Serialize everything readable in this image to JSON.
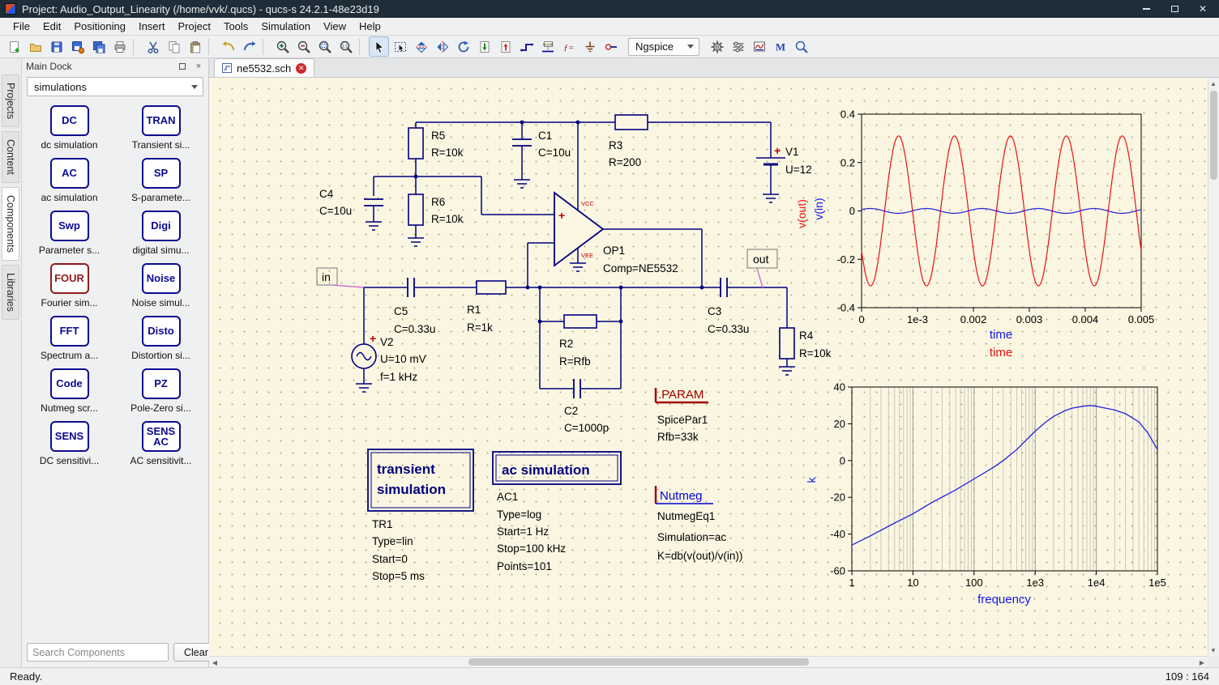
{
  "window": {
    "title": "Project: Audio_Output_Linearity (/home/vvk/.qucs) - qucs-s 24.2.1-48e23d19",
    "controls": [
      "minimize",
      "restore",
      "close"
    ]
  },
  "menus": [
    "File",
    "Edit",
    "Positioning",
    "Insert",
    "Project",
    "Tools",
    "Simulation",
    "View",
    "Help"
  ],
  "toolbar": {
    "simulator": "Ngspice",
    "icons": [
      "new",
      "open",
      "save",
      "save-as",
      "save-all",
      "print",
      "cut",
      "copy",
      "paste",
      "undo",
      "redo",
      "zoom-in",
      "zoom-out",
      "zoom-fit",
      "zoom-actual",
      "select",
      "select-area",
      "mirror-vertical",
      "mirror-horizontal",
      "rotate",
      "push-into",
      "pop-out",
      "wire",
      "node-name",
      "equation",
      "ground",
      "port",
      "simulate",
      "sim-settings",
      "display-data",
      "text-editor",
      "zoom-area"
    ]
  },
  "dock": {
    "title": "Main Dock",
    "selector": "simulations",
    "tabs": [
      "Projects",
      "Content",
      "Components",
      "Libraries"
    ],
    "items": [
      {
        "icon": "DC",
        "label": "dc simulation",
        "accent": "#0b0b8f"
      },
      {
        "icon": "TRAN",
        "label": "Transient si...",
        "accent": "#0b0b8f"
      },
      {
        "icon": "AC",
        "label": "ac simulation",
        "accent": "#0b0b8f"
      },
      {
        "icon": "SP",
        "label": "S-paramete...",
        "accent": "#0b0b8f"
      },
      {
        "icon": "Swp",
        "label": "Parameter s...",
        "accent": "#0b0b8f"
      },
      {
        "icon": "Digi",
        "label": "digital simu...",
        "accent": "#0b0b8f"
      },
      {
        "icon": "FOUR",
        "label": "Fourier sim...",
        "accent": "#8f1b1b"
      },
      {
        "icon": "Noise",
        "label": "Noise simul...",
        "accent": "#0b0b8f"
      },
      {
        "icon": "FFT",
        "label": "Spectrum a...",
        "accent": "#0b0b8f"
      },
      {
        "icon": "Disto",
        "label": "Distortion si...",
        "accent": "#0b0b8f"
      },
      {
        "icon": "Code",
        "label": "Nutmeg scr...",
        "accent": "#0b0b8f"
      },
      {
        "icon": "PZ",
        "label": "Pole-Zero si...",
        "accent": "#0b0b8f"
      },
      {
        "icon": "SENS",
        "label": "DC sensitivi...",
        "accent": "#0b0b8f"
      },
      {
        "icon": "SENS AC",
        "label": "AC sensitivit...",
        "accent": "#0b0b8f"
      }
    ],
    "search_placeholder": "Search Components",
    "clear_label": "Clear"
  },
  "canvas": {
    "tab": "ne5532.sch"
  },
  "schematic": {
    "colors": {
      "wire": "#000080",
      "accent_red": "#c00000",
      "label_link": "#d070d0"
    },
    "R5": {
      "name": "R5",
      "value": "R=10k"
    },
    "R6": {
      "name": "R6",
      "value": "R=10k"
    },
    "C4": {
      "name": "C4",
      "value": "C=10u"
    },
    "C1": {
      "name": "C1",
      "value": "C=10u"
    },
    "R3": {
      "name": "R3",
      "value": "R=200"
    },
    "V1": {
      "name": "V1",
      "value": "U=12",
      "plus": "+"
    },
    "OP1": {
      "name": "OP1",
      "value": "Comp=NE5532",
      "vcc": "VCC",
      "vee": "VEE",
      "plus": "+"
    },
    "C5": {
      "name": "C5",
      "value": "C=0.33u"
    },
    "R1": {
      "name": "R1",
      "value": "R=1k"
    },
    "V2": {
      "name": "V2",
      "value": "U=10 mV",
      "value2": "f=1 kHz",
      "plus": "+"
    },
    "R2": {
      "name": "R2",
      "value": "R=Rfb"
    },
    "C2": {
      "name": "C2",
      "value": "C=1000p"
    },
    "C3": {
      "name": "C3",
      "value": "C=0.33u"
    },
    "R4": {
      "name": "R4",
      "value": "R=10k"
    },
    "in_label": "in",
    "out_label": "out",
    "param": {
      "title": ".PARAM",
      "name": "SpicePar1",
      "value": "Rfb=33k"
    },
    "transient": {
      "title1": "transient",
      "title2": "simulation",
      "name": "TR1",
      "type": "Type=lin",
      "start": "Start=0",
      "stop": "Stop=5 ms"
    },
    "ac": {
      "title": "ac simulation",
      "name": "AC1",
      "type": "Type=log",
      "start": "Start=1 Hz",
      "stop": "Stop=100 kHz",
      "points": "Points=101"
    },
    "nutmeg": {
      "title": "Nutmeg",
      "name": "NutmegEq1",
      "sim": "Simulation=ac",
      "eq": "K=db(v(out)/v(in))"
    }
  },
  "chart_data": [
    {
      "type": "line",
      "name": "transient-waveforms",
      "xlim": [
        0,
        0.005
      ],
      "ylim": [
        -0.4,
        0.4
      ],
      "x_ticks": [
        {
          "v": 0,
          "label": "0"
        },
        {
          "v": 0.001,
          "label": "1e-3"
        },
        {
          "v": 0.002,
          "label": "0.002"
        },
        {
          "v": 0.003,
          "label": "0.003"
        },
        {
          "v": 0.004,
          "label": "0.004"
        },
        {
          "v": 0.005,
          "label": "0.005"
        }
      ],
      "y_ticks": [
        {
          "v": 0.4,
          "label": "0.4"
        },
        {
          "v": 0.2,
          "label": "0.2"
        },
        {
          "v": 0,
          "label": "0"
        },
        {
          "v": -0.2,
          "label": "-0.2"
        },
        {
          "v": -0.4,
          "label": "-0.4"
        }
      ],
      "axis_labels": {
        "x_blue": "time",
        "x_red": "time",
        "y_red": "v(out)",
        "y_blue": "v(in)"
      },
      "grid": false,
      "series": [
        {
          "name": "v(out)",
          "color": "#ee1111",
          "waveform": "sine",
          "amplitude": 0.31,
          "frequency_hz": 1000,
          "phase_rad": 3.7
        },
        {
          "name": "v(in)",
          "color": "#2222dd",
          "waveform": "sine",
          "amplitude": 0.01,
          "frequency_hz": 1000,
          "phase_rad": 0.6
        }
      ]
    },
    {
      "type": "line",
      "name": "gain-vs-frequency",
      "x_scale": "log",
      "xlim": [
        1,
        100000
      ],
      "ylim": [
        -60,
        40
      ],
      "x_ticks": [
        {
          "v": 1,
          "label": "1"
        },
        {
          "v": 10,
          "label": "10"
        },
        {
          "v": 100,
          "label": "100"
        },
        {
          "v": 1000,
          "label": "1e3"
        },
        {
          "v": 10000,
          "label": "1e4"
        },
        {
          "v": 100000,
          "label": "1e5"
        }
      ],
      "y_ticks": [
        {
          "v": 40,
          "label": "40"
        },
        {
          "v": 20,
          "label": "20"
        },
        {
          "v": 0,
          "label": "0"
        },
        {
          "v": -20,
          "label": "-20"
        },
        {
          "v": -40,
          "label": "-40"
        },
        {
          "v": -60,
          "label": "-60"
        }
      ],
      "axis_labels": {
        "x": "frequency",
        "y": "k"
      },
      "grid": "log-vertical",
      "series": [
        {
          "name": "K=db(v(out)/v(in))",
          "color": "#2222dd",
          "points": [
            [
              1,
              -46
            ],
            [
              2,
              -41
            ],
            [
              5,
              -34
            ],
            [
              10,
              -29
            ],
            [
              20,
              -23
            ],
            [
              50,
              -16
            ],
            [
              100,
              -10
            ],
            [
              200,
              -4
            ],
            [
              300,
              0
            ],
            [
              500,
              6
            ],
            [
              1000,
              16
            ],
            [
              1500,
              21
            ],
            [
              2000,
              24
            ],
            [
              3000,
              27
            ],
            [
              4000,
              28.5
            ],
            [
              6000,
              29.5
            ],
            [
              8000,
              30
            ],
            [
              10000,
              29.5
            ],
            [
              20000,
              27.5
            ],
            [
              30000,
              25.5
            ],
            [
              50000,
              21
            ],
            [
              70000,
              15
            ],
            [
              100000,
              6
            ]
          ]
        }
      ]
    }
  ],
  "statusbar": {
    "left": "Ready.",
    "right": "109 : 164"
  }
}
